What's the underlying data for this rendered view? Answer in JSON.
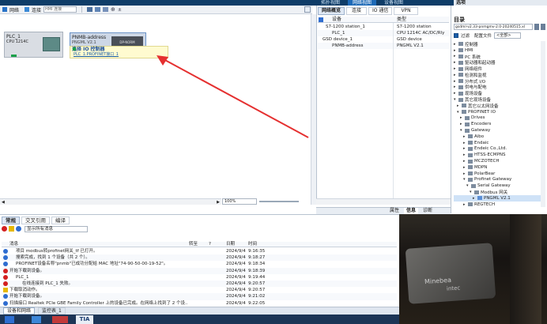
{
  "top_tabs": [
    "拓扑视图",
    "网络视图",
    "设备视图"
  ],
  "right_panel_title": "选项",
  "toolbar": {
    "network_label": "网络",
    "connection_label": "连接",
    "connection_select": "HMI 连接"
  },
  "devices": {
    "plc": {
      "name": "PLC_1",
      "type": "CPU 1214C"
    },
    "pnmb": {
      "name": "PNMB-address",
      "type": "PNGML V2.1",
      "badge": "DP-NORM"
    },
    "tooltip": {
      "line1": "选择 IO 控制器",
      "line2": "PLC_1.PROFINET接口_1"
    }
  },
  "zoom": "100%",
  "overview": {
    "tabs": [
      "网络概览",
      "连接",
      "IO 通信",
      "VPN"
    ],
    "headers": [
      "设备",
      "类型"
    ],
    "rows": [
      {
        "name": "S7-1200 station_1",
        "type": "S7-1200 station"
      },
      {
        "name": "PLC_1",
        "type": "CPU 1214C AC/DC/Rly"
      },
      {
        "name": "GSD device_1",
        "type": "GSD device"
      },
      {
        "name": "PNMB-address",
        "type": "PNGML V2.1"
      }
    ]
  },
  "catalog": {
    "title": "目录",
    "search": "gsdml-v2.33-pnmgmv-2.0-20240515.xl",
    "filter_label": "过滤",
    "profile_label": "配置文件",
    "profile_value": "<全部>",
    "tree": [
      {
        "label": "控制器",
        "level": 0,
        "open": false
      },
      {
        "label": "HMI",
        "level": 0,
        "open": false
      },
      {
        "label": "PC 系统",
        "level": 0,
        "open": false
      },
      {
        "label": "驱动器和起动器",
        "level": 0,
        "open": false
      },
      {
        "label": "网络组件",
        "level": 0,
        "open": false
      },
      {
        "label": "检测和监视",
        "level": 0,
        "open": false
      },
      {
        "label": "分布式 I/O",
        "level": 0,
        "open": false
      },
      {
        "label": "供电与配电",
        "level": 0,
        "open": false
      },
      {
        "label": "现场设备",
        "level": 0,
        "open": false
      },
      {
        "label": "其它现场设备",
        "level": 0,
        "open": true
      },
      {
        "label": "其它以太网设备",
        "level": 1,
        "open": false
      },
      {
        "label": "PROFINET IO",
        "level": 1,
        "open": true
      },
      {
        "label": "Drives",
        "level": 2,
        "open": false
      },
      {
        "label": "Encoders",
        "level": 2,
        "open": false
      },
      {
        "label": "Gateway",
        "level": 2,
        "open": true
      },
      {
        "label": "Aibo",
        "level": 3,
        "open": false
      },
      {
        "label": "Endaic",
        "level": 3,
        "open": false
      },
      {
        "label": "Endeic Co.,Ltd.",
        "level": 3,
        "open": false
      },
      {
        "label": "HTSS-ECMPNS",
        "level": 3,
        "open": false
      },
      {
        "label": "MCZOTECH",
        "level": 3,
        "open": false
      },
      {
        "label": "MDPN",
        "level": 3,
        "open": false
      },
      {
        "label": "PolarBear",
        "level": 3,
        "open": false
      },
      {
        "label": "Profinet Gateway",
        "level": 3,
        "open": true
      },
      {
        "label": "Serial Gateway",
        "level": 4,
        "open": true
      },
      {
        "label": "Modbus 网关",
        "level": 5,
        "open": true
      },
      {
        "label": "PNGML V2.1",
        "level": 6,
        "open": false,
        "selected": true
      },
      {
        "label": "REGTECH",
        "level": 3,
        "open": false
      }
    ]
  },
  "inspector_tabs": [
    "属性",
    "信息",
    "诊断"
  ],
  "bottom_tabs": [
    "常规",
    "交叉引用",
    "编译"
  ],
  "filter_text": "显示所有消息",
  "messages": {
    "headers": [
      "消息",
      "转至",
      "?",
      "日期",
      "时间"
    ],
    "rows": [
      {
        "icon": "info",
        "indent": 1,
        "text": "项目 modbus转profinet网关_tf 已打开。",
        "date": "2024/9/4",
        "time": "9:16:35"
      },
      {
        "icon": "info",
        "indent": 1,
        "text": "搜索完成，找到 1 个设备（共 2 个）。",
        "date": "2024/9/4",
        "time": "9:18:27"
      },
      {
        "icon": "info",
        "indent": 1,
        "text": "PROFINET设备名称\"pnmb\"已成功分配给 MAC 地址\"74-90-50-00-19-52\"。",
        "date": "2024/9/4",
        "time": "9:18:34"
      },
      {
        "icon": "error",
        "indent": 0,
        "text": "开始下载到设备。",
        "date": "2024/9/4",
        "time": "9:18:39"
      },
      {
        "icon": "error",
        "indent": 1,
        "text": "PLC_1",
        "date": "2024/9/4",
        "time": "9:19:44"
      },
      {
        "icon": "error",
        "indent": 2,
        "text": "在线连接到 PLC_1 失败。",
        "date": "2024/9/4",
        "time": "9:20:57"
      },
      {
        "icon": "warning",
        "indent": 0,
        "text": "下载取消动作。",
        "date": "2024/9/4",
        "time": "9:20:57"
      },
      {
        "icon": "info",
        "indent": 0,
        "text": "开始下载到设备。",
        "date": "2024/9/4",
        "time": "9:21:02"
      },
      {
        "icon": "info",
        "indent": 0,
        "text": "扫描接口 Realtek PCIe GBE Family Controller 上的设备已完成。在网络上找到了 2 个设...",
        "date": "2024/9/4",
        "time": "9:22:05"
      }
    ]
  },
  "status_tabs": [
    "设备和网络",
    "监控表_1"
  ],
  "taskbar_label": "TIA",
  "photo": {
    "brand1": "Minebea",
    "brand2": "intec"
  },
  "colors": {
    "accent": "#1b5fa8",
    "selection": "#cfe2f7",
    "arrow": "#e53030",
    "error": "#d32020",
    "info": "#2f6dd0",
    "warning": "#e6b800"
  }
}
